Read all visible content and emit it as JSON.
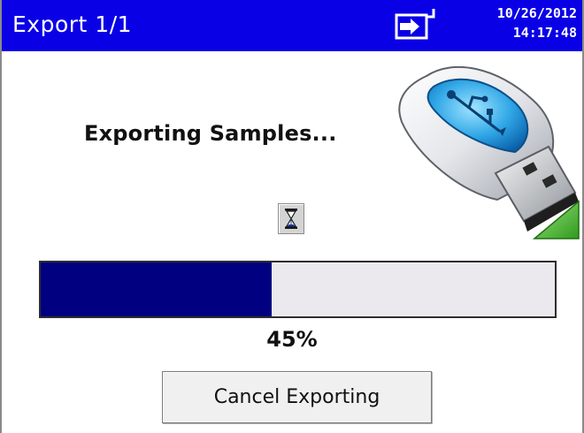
{
  "header": {
    "title": "Export 1/1",
    "date": "10/26/2012",
    "time": "14:17:48",
    "icon": "export-to-device-icon",
    "background_color": "#0a00e6"
  },
  "main": {
    "status_message": "Exporting Samples...",
    "busy_icon": "hourglass-icon",
    "device_graphic": "usb-flash-drive-icon",
    "progress": {
      "percent": 45,
      "label": "45%",
      "fill_color": "#000080",
      "track_color": "#ece9ee"
    },
    "cancel_button_label": "Cancel Exporting"
  }
}
